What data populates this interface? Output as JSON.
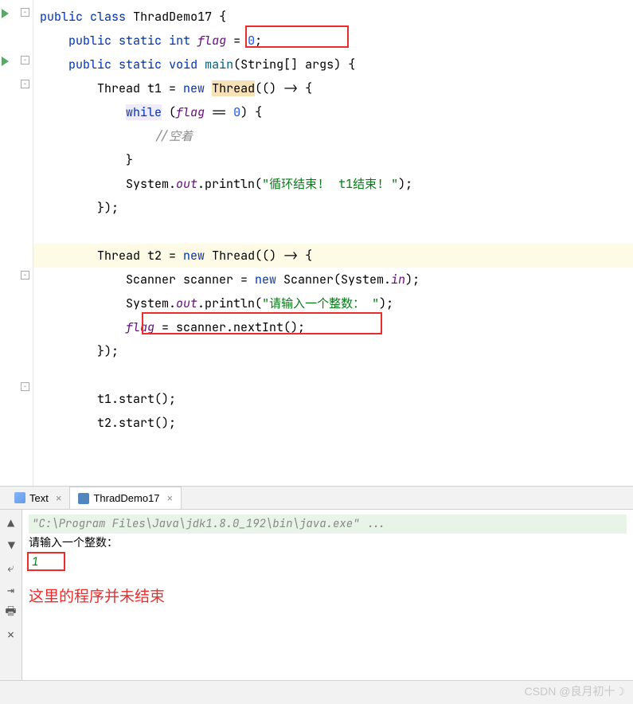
{
  "code": {
    "l1_public": "public",
    "l1_class": "class",
    "l1_name": "ThradDemo17",
    "l2_public": "public",
    "l2_static": "static",
    "l2_int": "int",
    "l2_flag": "flag",
    "l2_eq": " = ",
    "l2_zero": "0",
    "l2_semi": ";",
    "l3_public": "public",
    "l3_static": "static",
    "l3_void": "void",
    "l3_main": "main",
    "l3_string": "String",
    "l3_args": "args",
    "l4_thread": "Thread",
    "l4_t1": " t1 = ",
    "l4_new": "new",
    "l4_thread2": "Thread",
    "l4_arrow": "(() -> {",
    "l5_while": "while",
    "l5_flag": "flag",
    "l5_cond": " == ",
    "l5_zero": "0",
    "l6_comment": "//空着",
    "l8_sys": "System.",
    "l8_out": "out",
    "l8_println": ".println(",
    "l8_str": "\"循环结束!  t1结束! \"",
    "l8_end": ");",
    "l11_thread": "Thread",
    "l11_t2": " t2 = ",
    "l11_new": "new",
    "l11_thread2": "Thread",
    "l11_arrow": "(() -> {",
    "l12_scanner": "Scanner scanner = ",
    "l12_new": "new",
    "l12_scan2": " Scanner(System.",
    "l12_in": "in",
    "l12_end": ");",
    "l13_sys": "System.",
    "l13_out": "out",
    "l13_println": ".println(",
    "l13_str": "\"请输入一个整数： \"",
    "l13_end": ");",
    "l14_flag": "flag",
    "l14_eq": " = scanner.nextInt();",
    "l15_end": "});",
    "l17_t1start": "t1.start();",
    "l18_t2start": "t2.start();"
  },
  "tabs": {
    "text": "Text",
    "demo": "ThradDemo17"
  },
  "console": {
    "cmd": "\"C:\\Program Files\\Java\\jdk1.8.0_192\\bin\\java.exe\" ...",
    "prompt": "请输入一个整数：",
    "input": "1",
    "annotation": "这里的程序并未结束"
  },
  "watermark": "CSDN @良月初十☽"
}
